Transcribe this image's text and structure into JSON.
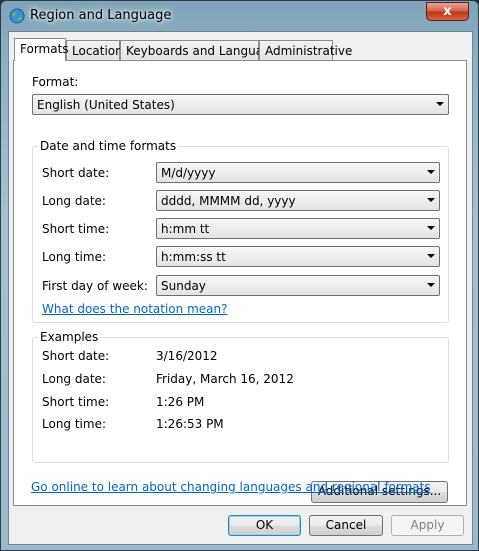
{
  "window": {
    "title": "Region and Language",
    "icon": "globe-icon",
    "close_glyph": "x"
  },
  "tabs": [
    {
      "label": "Formats",
      "active": true
    },
    {
      "label": "Location",
      "active": false
    },
    {
      "label": "Keyboards and Languages",
      "active": false
    },
    {
      "label": "Administrative",
      "active": false
    }
  ],
  "format": {
    "label": "Format:",
    "value": "English (United States)"
  },
  "date_time_formats": {
    "title": "Date and time formats",
    "short_date": {
      "label": "Short date:",
      "value": "M/d/yyyy"
    },
    "long_date": {
      "label": "Long date:",
      "value": "dddd, MMMM dd, yyyy"
    },
    "short_time": {
      "label": "Short time:",
      "value": "h:mm tt"
    },
    "long_time": {
      "label": "Long time:",
      "value": "h:mm:ss tt"
    },
    "first_day": {
      "label": "First day of week:",
      "value": "Sunday"
    },
    "notation_link": "What does the notation mean?"
  },
  "examples": {
    "title": "Examples",
    "short_date": {
      "label": "Short date:",
      "value": "3/16/2012"
    },
    "long_date": {
      "label": "Long date:",
      "value": "Friday, March 16, 2012"
    },
    "short_time": {
      "label": "Short time:",
      "value": "1:26 PM"
    },
    "long_time": {
      "label": "Long time:",
      "value": "1:26:53 PM"
    }
  },
  "additional_settings": "Additional settings...",
  "online_link": "Go online to learn about changing languages and regional formats",
  "buttons": {
    "ok": "OK",
    "cancel": "Cancel",
    "apply": "Apply"
  },
  "colors": {
    "link": "#0066cc",
    "close_button": "#c4361c",
    "frame": "#8fb1c4"
  }
}
